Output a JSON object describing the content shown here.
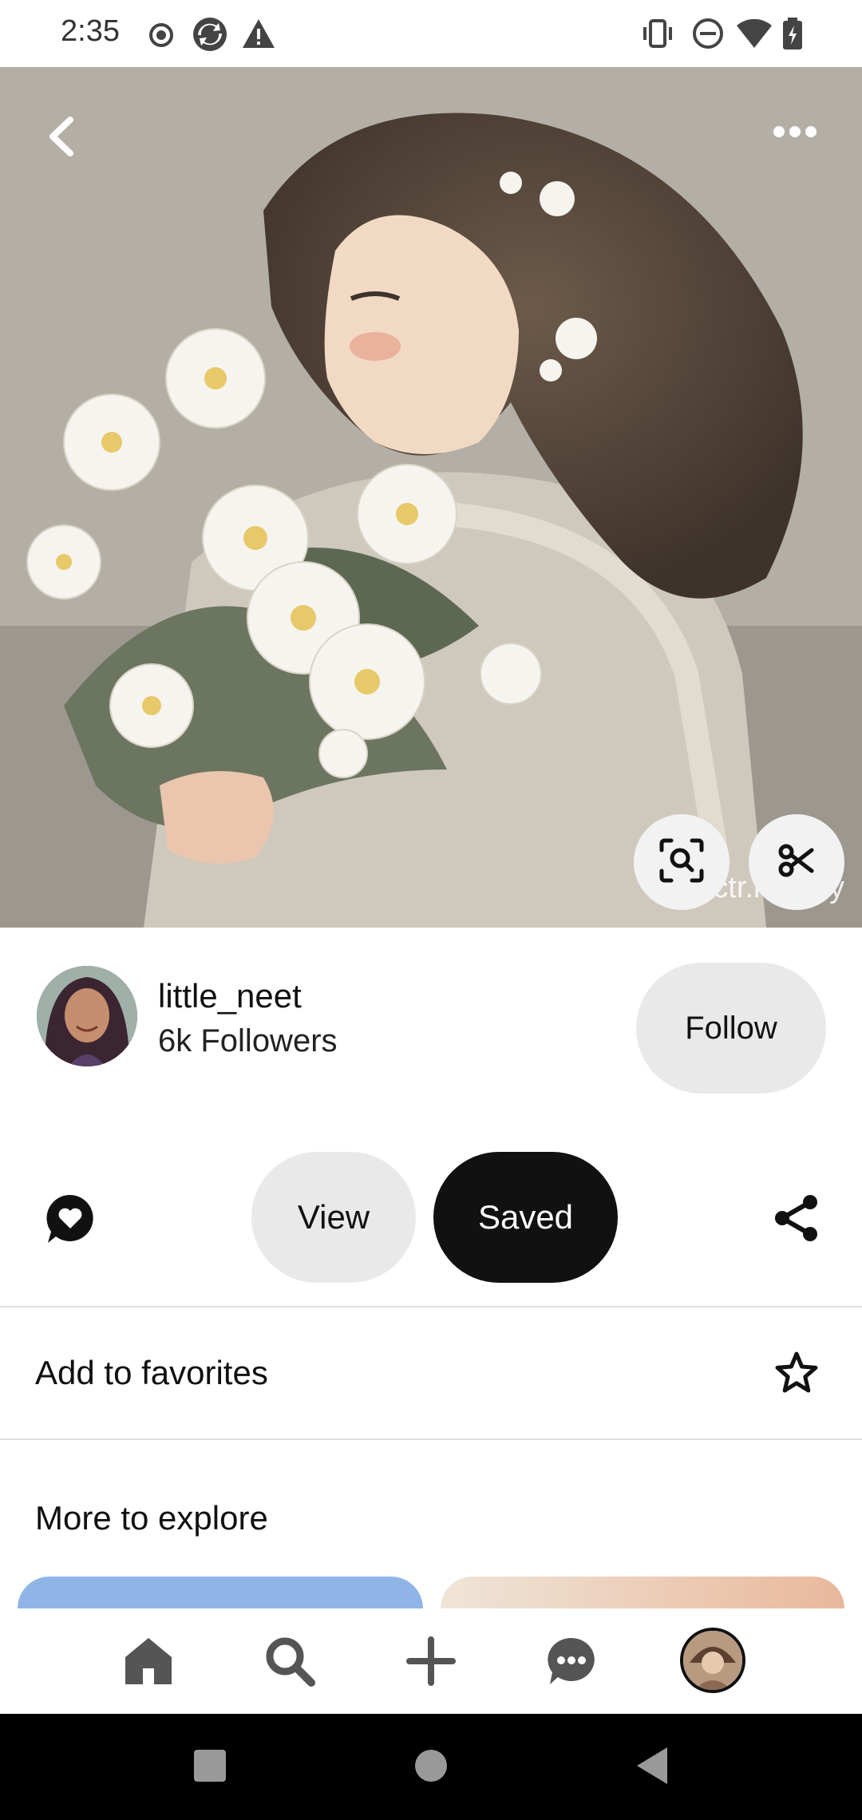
{
  "status_bar": {
    "time": "2:35",
    "icons": [
      "record-icon",
      "sync-icon",
      "warning-icon",
      "vibrate-icon",
      "do-not-disturb-icon",
      "wifi-icon",
      "battery-icon"
    ]
  },
  "pin": {
    "watermark": "@@ctr.mebby",
    "top_icons": [
      "back-icon",
      "more-icon"
    ],
    "overlay_icons": [
      "visual-search-icon",
      "cutout-icon"
    ]
  },
  "creator": {
    "name": "little_neet",
    "followers": "6k Followers",
    "follow_label": "Follow"
  },
  "actions": {
    "view_label": "View",
    "saved_label": "Saved",
    "comment_icon": "comment-heart-icon",
    "share_icon": "share-icon"
  },
  "favorites": {
    "label": "Add to favorites",
    "icon": "star-icon"
  },
  "explore": {
    "title": "More to explore"
  },
  "bottom_nav": {
    "items": [
      "home-icon",
      "search-icon",
      "create-icon",
      "messages-icon",
      "profile-avatar"
    ]
  },
  "colors": {
    "accent_dark": "#111111",
    "pill_light": "#e9e9e9",
    "divider": "#dddddd"
  }
}
